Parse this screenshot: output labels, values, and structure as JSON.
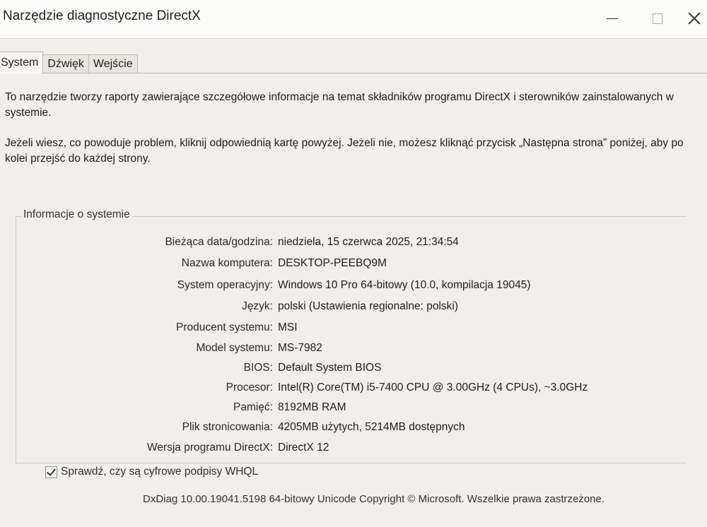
{
  "window": {
    "title": "Narzędzie diagnostyczne DirectX"
  },
  "tabs": [
    {
      "label": "System",
      "active": true
    },
    {
      "label": "Dźwięk",
      "active": false
    },
    {
      "label": "Wejście",
      "active": false
    }
  ],
  "description": {
    "line1": "To narzędzie tworzy raporty zawierające szczegółowe informacje na temat składników programu DirectX i sterowników zainstalowanych w systemie.",
    "line2": "Jeżeli wiesz, co powoduje problem, kliknij odpowiednią kartę powyżej. Jeżeli nie, możesz kliknąć przycisk „Następna strona” poniżej, aby po kolei przejść do każdej strony."
  },
  "group": {
    "title": "Informacje o systemie",
    "rows": [
      {
        "label": "Bieżąca data/godzina:",
        "value": "niedziela, 15 czerwca 2025, 21:34:54"
      },
      {
        "label": "Nazwa komputera:",
        "value": "DESKTOP-PEEBQ9M"
      },
      {
        "label": "System operacyjny:",
        "value": "Windows 10 Pro 64-bitowy (10.0, kompilacja 19045)"
      },
      {
        "label": "Język:",
        "value": "polski (Ustawienia regionalne: polski)"
      },
      {
        "label": "Producent systemu:",
        "value": "MSI"
      },
      {
        "label": "Model systemu:",
        "value": "MS-7982"
      },
      {
        "label": "BIOS:",
        "value": "Default System BIOS"
      },
      {
        "label": "Procesor:",
        "value": "Intel(R) Core(TM) i5-7400 CPU @ 3.00GHz (4 CPUs), ~3.0GHz"
      },
      {
        "label": "Pamięć:",
        "value": "8192MB RAM"
      },
      {
        "label": "Plik stronicowania:",
        "value": "4205MB użytych, 5214MB dostępnych"
      },
      {
        "label": "Wersja programu DirectX:",
        "value": "DirectX 12"
      }
    ]
  },
  "whql_check": {
    "label": "Sprawdź, czy są cyfrowe podpisy WHQL",
    "checked": true
  },
  "footer": {
    "text": "DxDiag 10.00.19041.5198 64-bitowy Unicode  Copyright © Microsoft. Wszelkie prawa zastrzeżone."
  }
}
